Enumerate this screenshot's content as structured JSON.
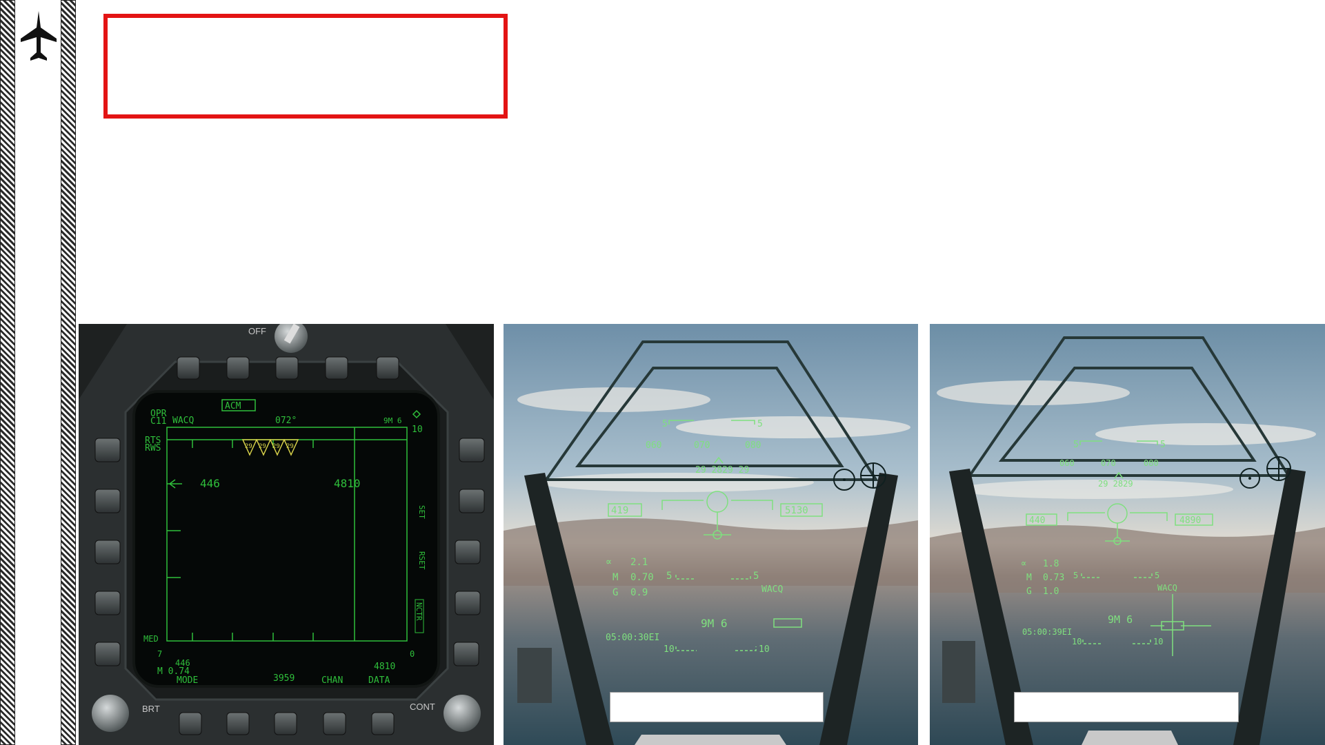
{
  "slide": {
    "sidebar_icon": "fighter-jet-icon",
    "title_box_color": "#e31414"
  },
  "ddi": {
    "knob_label": "OFF",
    "acm_label": "ACM",
    "opr_label": "OPR",
    "c11_label": "C11",
    "wacq_label": "WACQ",
    "heading": "072°",
    "sm_label": "9M 6",
    "range_top": "10",
    "rts_label": "RTS",
    "rws_label": "RWS",
    "left_value": "446",
    "right_value": "4810",
    "contact_label": "29",
    "set_label": "SET",
    "rset_label": "RSET",
    "nctr_label": "NCTR",
    "med_label": "MED",
    "seven_label": "7",
    "zero_label": "0",
    "bottom_left_value": "446",
    "mach_readout": "M 0.74",
    "bottom_right_value": "4810",
    "mode_label": "MODE",
    "center_value": "3959",
    "chan_label": "CHAN",
    "data_label": "DATA",
    "brt_label": "BRT",
    "cont_label": "CONT"
  },
  "hud1": {
    "pitch_5_left": "5",
    "pitch_5_right": "5",
    "heading_060": "060",
    "heading_070": "070",
    "heading_080": "080",
    "contacts": "29 2829 29",
    "airspeed": "419",
    "altitude": "5130",
    "alpha_symbol": "∝",
    "alpha": "2.1",
    "mach_label": "M",
    "mach": "0.70",
    "g_label": "G",
    "g": "0.9",
    "pitch_n5_left": "5",
    "pitch_n5_right": "5",
    "wacq": "WACQ",
    "weapon": "9M 6",
    "time": "05:00:30EI",
    "pitch_n10_left": "10",
    "pitch_n10_right": "10"
  },
  "hud2": {
    "pitch_5_left": "5",
    "pitch_5_right": "5",
    "heading_060": "060",
    "heading_070": "070",
    "heading_080": "080",
    "contacts": "29 2829",
    "airspeed": "440",
    "altitude": "4890",
    "alpha_symbol": "∝",
    "alpha": "1.8",
    "mach_label": "M",
    "mach": "0.73",
    "g_label": "G",
    "g": "1.0",
    "pitch_n5_left": "5",
    "pitch_n5_right": "5",
    "wacq": "WACQ",
    "weapon": "9M 6",
    "time": "05:00:39EI",
    "pitch_n10_left": "10",
    "pitch_n10_right": "10"
  }
}
